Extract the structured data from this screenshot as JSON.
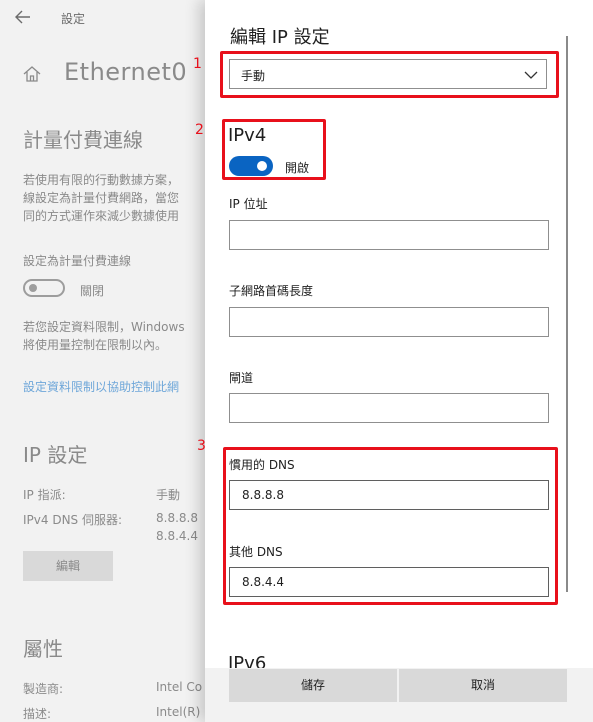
{
  "background": {
    "app_title": "設定",
    "page_title": "Ethernet0",
    "metered_heading": "計量付費連線",
    "metered_desc": [
      "若使用有限的行動數據方案，",
      "線設定為計量付費網路，當您",
      "同的方式運作來減少數據使用"
    ],
    "set_metered_label": "設定為計量付費連線",
    "metered_toggle_state": "關閉",
    "limit_desc": [
      "若您設定資料限制，Windows",
      "將使用量控制在限制以內。"
    ],
    "limit_link": "設定資料限制以協助控制此網",
    "ip_heading": "IP 設定",
    "ip_assign_label": "IP 指派:",
    "ip_assign_value": "手動",
    "dns_label": "IPv4 DNS 伺服器:",
    "dns_values": [
      "8.8.8.8",
      "8.8.4.4"
    ],
    "edit_button": "編輯",
    "properties_heading": "屬性",
    "manufacturer_label": "製造商:",
    "manufacturer_value": "Intel Co",
    "description_label": "描述:",
    "description_value": "Intel(R)"
  },
  "dialog": {
    "title": "編輯 IP 設定",
    "mode_select": "手動",
    "ipv4_heading": "IPv4",
    "ipv4_toggle_label": "開啟",
    "fields": {
      "ip_address_label": "IP 位址",
      "ip_address_value": "",
      "subnet_label": "子網路首碼長度",
      "subnet_value": "",
      "gateway_label": "閘道",
      "gateway_value": "",
      "preferred_dns_label": "慣用的 DNS",
      "preferred_dns_value": "8.8.8.8",
      "alternate_dns_label": "其他 DNS",
      "alternate_dns_value": "8.8.4.4"
    },
    "ipv6_heading": "IPv6",
    "save_button": "儲存",
    "cancel_button": "取消"
  },
  "annotations": [
    "1",
    "2",
    "3"
  ],
  "colors": {
    "accent": "#0a64c2",
    "annotation": "#e8101b",
    "link": "#6fa7d9"
  }
}
